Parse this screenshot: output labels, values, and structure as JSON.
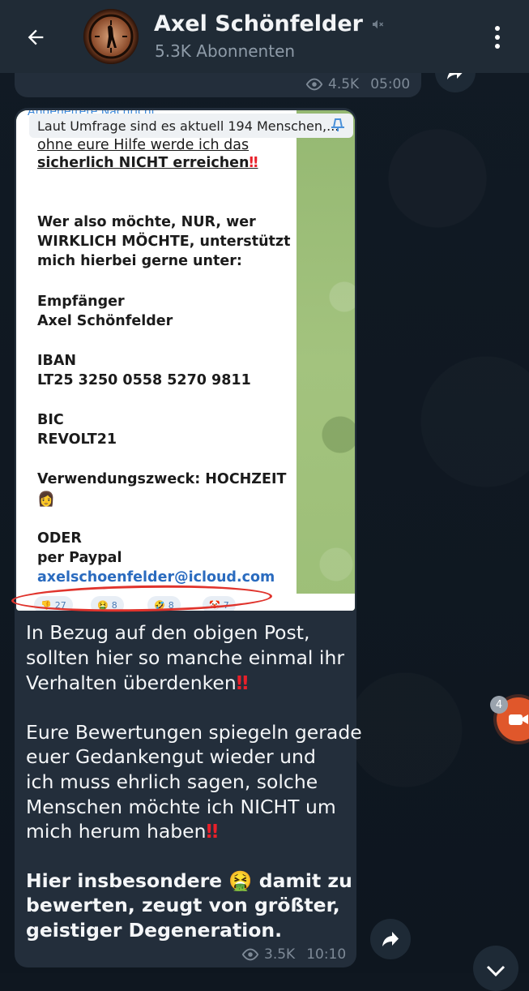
{
  "header": {
    "title": "Axel Schönfelder",
    "subscribers": "5.3K Abonnenten",
    "back_icon": "arrow-left-icon",
    "mute_icon": "muted-speaker-icon",
    "menu_icon": "more-vertical-icon"
  },
  "previous_message": {
    "views": "4.5K",
    "time": "05:00"
  },
  "message": {
    "photo": {
      "cut_header": "Angeheftete Nachricht",
      "pinned_preview": "Laut Umfrage sind es aktuell 194 Menschen,...",
      "lines": [
        "ohne eure Hilfe werde ich das",
        "sicherlich NICHT erreichen",
        "Wer also möchte, NUR, wer",
        "WIRKLICH MÖCHTE, unterstützt",
        "mich hierbei gerne unter:",
        "Empfänger",
        "Axel Schönfelder",
        "IBAN",
        "LT25 3250 0558 5270 9811",
        "BIC",
        "REVOLT21",
        "Verwendungszweck: HOCHZEIT",
        "ODER",
        "per Paypal",
        "axelschoenfelder@icloud.com"
      ],
      "reactions": [
        {
          "emoji": "👎",
          "count": "27"
        },
        {
          "emoji": "🤮",
          "count": "8"
        },
        {
          "emoji": "🤣",
          "count": "8"
        },
        {
          "emoji": "🤡",
          "count": "7"
        }
      ]
    },
    "paragraphs": [
      "In Bezug auf den obigen Post,",
      "sollten hier so manche einmal ihr",
      "Verhalten überdenken",
      "Eure Bewertungen spiegeln gerade",
      "euer Gedankengut wieder und",
      "ich muss ehrlich sagen, solche",
      "Menschen möchte ich NICHT um",
      "mich herum haben",
      "Hier insbesondere",
      "damit zu",
      "bewerten, zeugt von größter,",
      "geistiger Degeneration."
    ],
    "views": "3.5K",
    "time": "10:10"
  },
  "floating": {
    "camera_badge": "4"
  },
  "colors": {
    "header_bg": "#202b36",
    "bubble_bg": "#232e3b",
    "accent_red": "#e0332c",
    "camera_orange": "#e0572b"
  }
}
